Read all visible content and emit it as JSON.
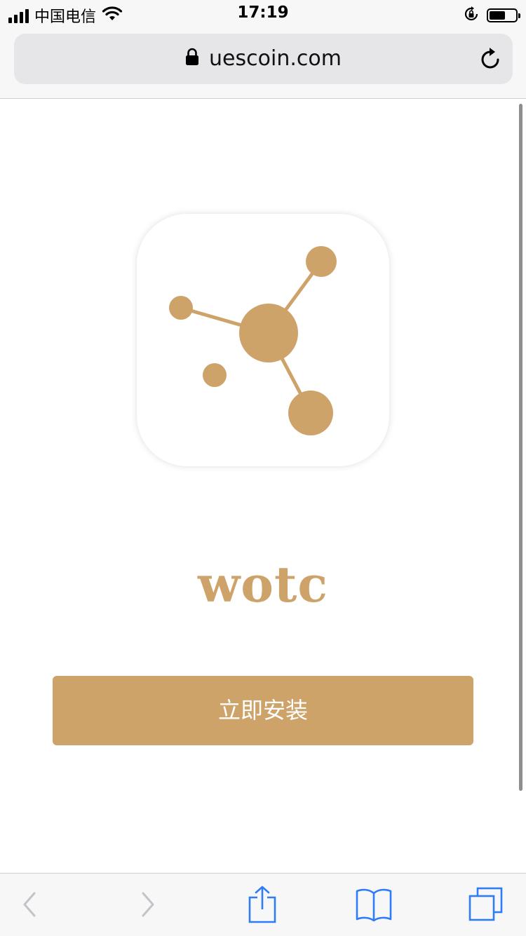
{
  "status_bar": {
    "carrier": "中国电信",
    "time": "17:19",
    "icons": [
      "signal-icon",
      "wifi-icon",
      "orientation-lock-icon",
      "battery-icon"
    ]
  },
  "address_bar": {
    "url": "uescoin.com",
    "icons": [
      "lock-icon",
      "reload-icon"
    ]
  },
  "app": {
    "name": "wotc",
    "icon": "molecule-logo-icon",
    "install_label": "立即安装"
  },
  "toolbar": {
    "icons": [
      "back-icon",
      "forward-icon",
      "share-icon",
      "bookmarks-icon",
      "tabs-icon"
    ]
  },
  "colors": {
    "brand": "#cda36a",
    "ios_blue": "#2e7cf6",
    "disabled": "#c3c3c8",
    "bar_bg": "#f7f7f7"
  }
}
